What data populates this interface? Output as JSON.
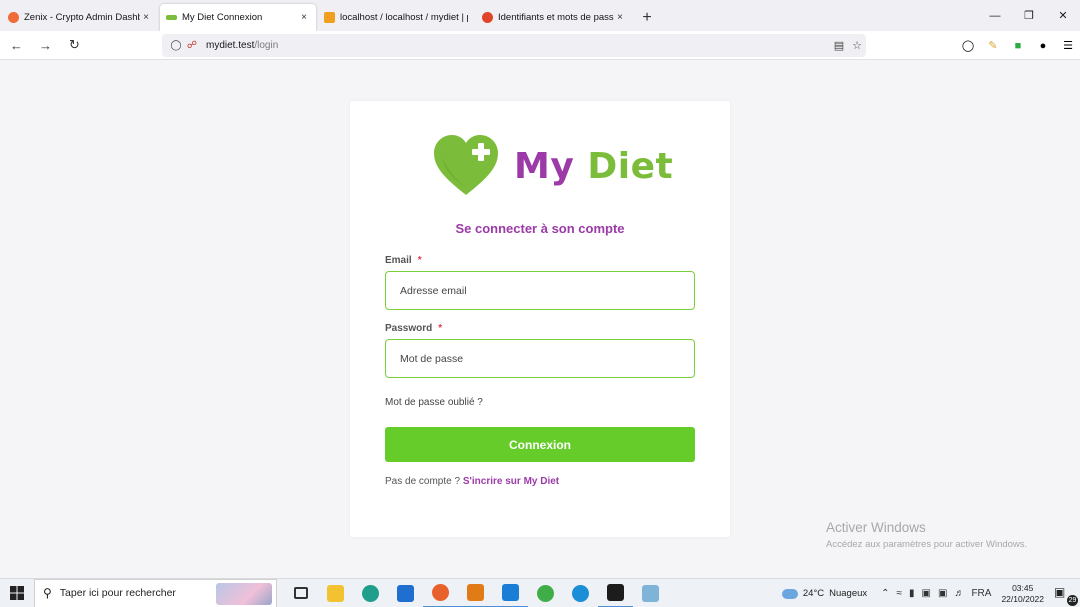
{
  "browser": {
    "tabs": [
      {
        "title": "Zenix - Crypto Admin Dashboard",
        "favicon_color": "#ef6b3a",
        "active": false
      },
      {
        "title": "My Diet Connexion",
        "favicon_color": "#7bbd3a",
        "active": true
      },
      {
        "title": "localhost / localhost / mydiet | p",
        "favicon_color": "#f0a020",
        "active": false
      },
      {
        "title": "Identifiants et mots de passe",
        "favicon_color": "#e0452b",
        "active": false
      }
    ],
    "close_glyph": "×",
    "new_tab_glyph": "+",
    "url_host": "mydiet.test",
    "url_path": "/login"
  },
  "page": {
    "brand_my": "My",
    "brand_diet": "Diet",
    "subtitle": "Se connecter à son compte",
    "email_label": "Email",
    "email_placeholder": "Adresse email",
    "password_label": "Password",
    "password_placeholder": "Mot de passe",
    "required_mark": "*",
    "forgot_link": "Mot de passe oublié ?",
    "submit_label": "Connexion",
    "signup_prompt": "Pas de compte ?",
    "signup_link": "S'incrire sur My Diet",
    "colors": {
      "purple": "#9c3aa8",
      "green": "#7bbd3a",
      "button": "#66cc2a"
    }
  },
  "watermark": {
    "title": "Activer Windows",
    "subtitle": "Accédez aux paramètres pour activer Windows."
  },
  "taskbar": {
    "search_placeholder": "Taper ici pour rechercher",
    "weather_temp": "24°C",
    "weather_text": "Nuageux",
    "language": "FRA",
    "time": "03:45",
    "date": "22/10/2022",
    "notification_count": "29",
    "apps": [
      "task-view",
      "file-explorer",
      "edge",
      "mail",
      "firefox",
      "sublime-text",
      "vscode",
      "chrome",
      "app-blue",
      "terminal",
      "app-misc"
    ]
  }
}
